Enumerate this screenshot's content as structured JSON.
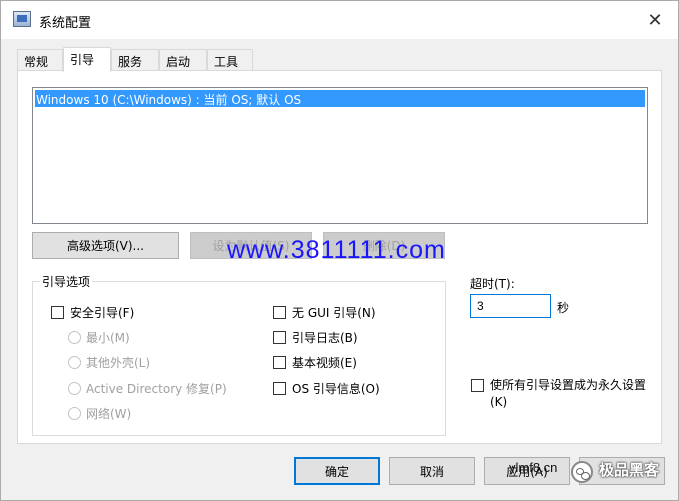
{
  "window": {
    "title": "系统配置"
  },
  "tabs": [
    "常规",
    "引导",
    "服务",
    "启动",
    "工具"
  ],
  "os_list": {
    "items": [
      "Windows 10 (C:\\Windows) : 当前 OS; 默认 OS"
    ]
  },
  "actions": {
    "advanced": "高级选项(V)...",
    "set_default": "设为默认值(S)",
    "delete": "删除(D)"
  },
  "boot_options": {
    "title": "引导选项",
    "safe_boot": "安全引导(F)",
    "minimal": "最小(M)",
    "alternate_shell": "其他外壳(L)",
    "ad_repair": "Active Directory 修复(P)",
    "network": "网络(W)",
    "no_gui": "无 GUI 引导(N)",
    "boot_log": "引导日志(B)",
    "base_video": "基本视频(E)",
    "os_info": "OS 引导信息(O)"
  },
  "timeout": {
    "label": "超时(T):",
    "value": "3",
    "unit": "秒"
  },
  "permanent": "使所有引导设置成为永久设置(K)",
  "footer": {
    "ok": "确定",
    "cancel": "取消",
    "apply": "应用(A)"
  },
  "overlay": {
    "watermark": "www.3811111.com",
    "bottom_watermark": "ylmf8.cn",
    "brand": "极品黑客"
  },
  "colors": {
    "selection": "#3399ff",
    "focus": "#0078d7",
    "watermark": "#1a15ff"
  }
}
